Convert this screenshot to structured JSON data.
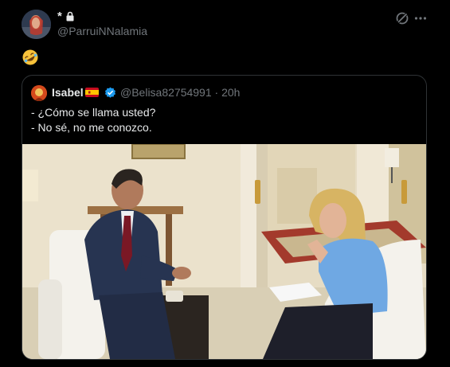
{
  "tweet": {
    "display_name": "*",
    "handle": "@ParruiNNalamia",
    "body_emoji_icon": "rolling-on-floor-laughing-emoji",
    "header_icons": [
      "lock-icon",
      "grok-icon",
      "more-options-icon"
    ]
  },
  "quoted_tweet": {
    "display_name": "Isabel",
    "flag_icon": "spain-flag-emoji",
    "verified_icon": "verified-badge-icon",
    "handle": "@Belisa82754991",
    "separator": "·",
    "time": "20h",
    "lines": [
      "- ¿Cómo se llama usted?",
      "- No sé, no me conozco."
    ]
  },
  "colors": {
    "background": "#000000",
    "text_primary": "#e7e9ea",
    "text_secondary": "#71767b",
    "border": "#2f3336",
    "verified": "#1d9bf0"
  }
}
